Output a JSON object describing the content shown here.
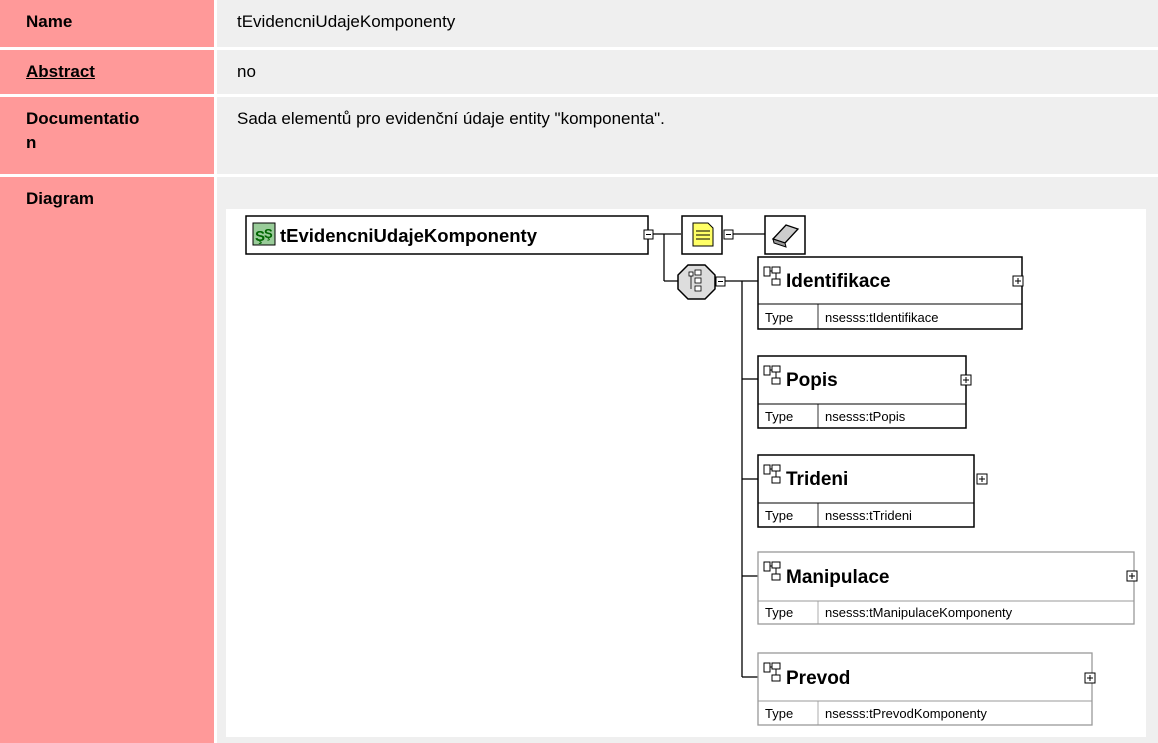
{
  "rows": {
    "name": {
      "label": "Name",
      "value": "tEvidencniUdajeKomponenty"
    },
    "abstract": {
      "label": "Abstract",
      "value": "no"
    },
    "documentation": {
      "label_line1": "Documentatio",
      "label_line2": "n",
      "value": "Sada elementů pro evidenční údaje entity \"komponenta\"."
    },
    "diagram": {
      "label": "Diagram"
    }
  },
  "diagram": {
    "root": {
      "name": "tEvidencniUdajeKomponenty",
      "icon": "complex-type-icon"
    },
    "annotation_icons": [
      "documentation-icon",
      "appinfo-icon"
    ],
    "compositor_icon": "sequence-icon",
    "type_label": "Type",
    "elements": [
      {
        "name": "Identifikace",
        "type": "nsesss:tIdentifikace"
      },
      {
        "name": "Popis",
        "type": "nsesss:tPopis"
      },
      {
        "name": "Trideni",
        "type": "nsesss:tTrideni"
      },
      {
        "name": "Manipulace",
        "type": "nsesss:tManipulaceKomponenty"
      },
      {
        "name": "Prevod",
        "type": "nsesss:tPrevodKomponenty"
      }
    ]
  },
  "colors": {
    "label_bg": "#ff9999",
    "value_bg": "#efefef",
    "doc_yellow": "#ffff66",
    "type_green": "#66cc66"
  }
}
